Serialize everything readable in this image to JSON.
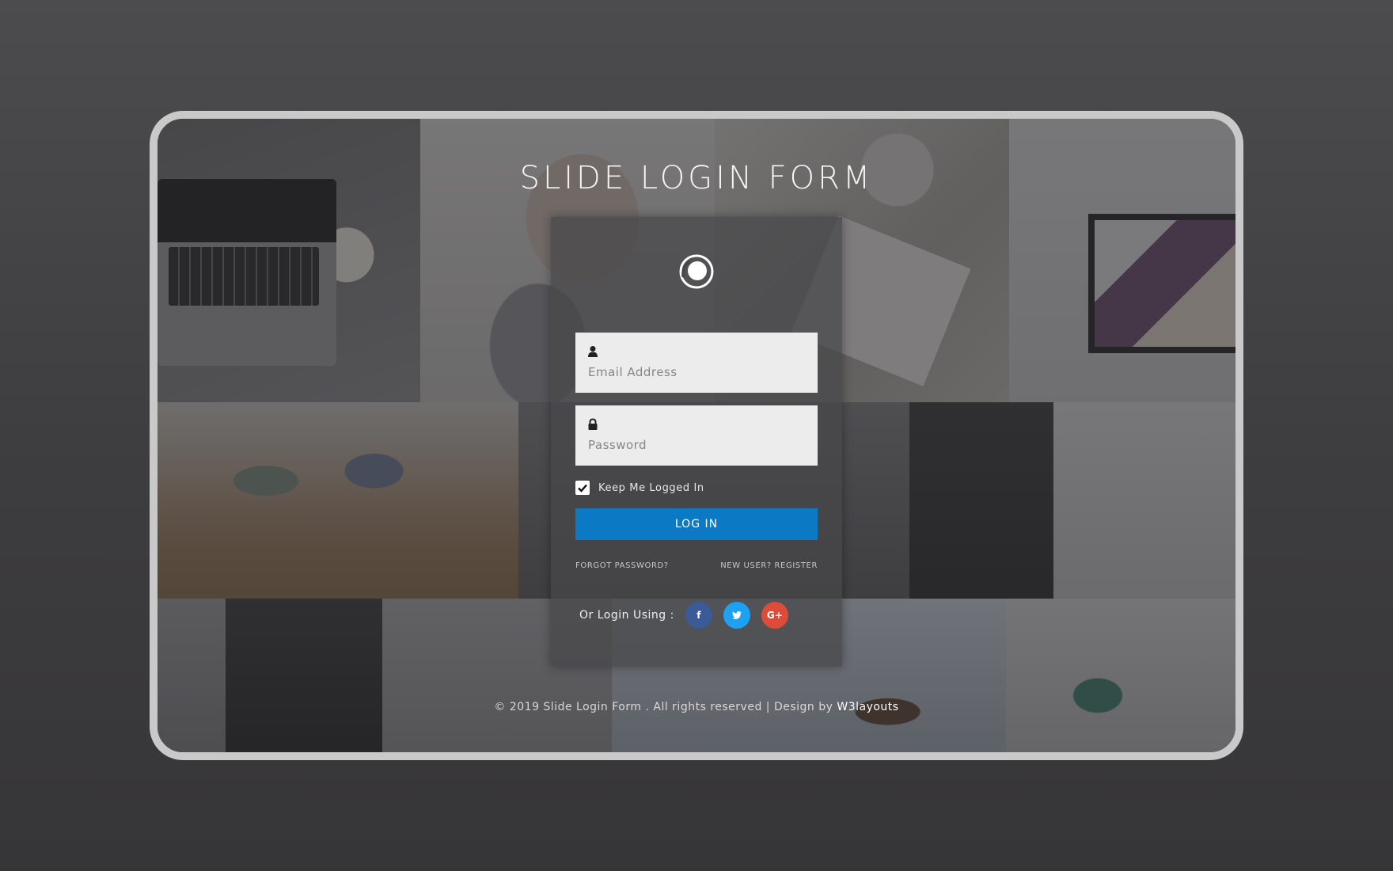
{
  "page": {
    "title": "SLIDE LOGIN FORM"
  },
  "form": {
    "email": {
      "value": "",
      "placeholder": "Email Address",
      "icon": "user-icon"
    },
    "password": {
      "value": "",
      "placeholder": "Password",
      "icon": "lock-icon"
    },
    "remember": {
      "label": "Keep Me Logged In",
      "checked": true
    },
    "login_label": "LOG IN",
    "forgot_label": "FORGOT PASSWORD?",
    "register_label": "NEW USER? REGISTER"
  },
  "social": {
    "label": "Or Login Using :",
    "buttons": [
      {
        "name": "facebook",
        "glyph": "f",
        "color": "#3a5a98"
      },
      {
        "name": "twitter",
        "glyph": "t",
        "color": "#1da1f2"
      },
      {
        "name": "google-plus",
        "glyph": "G+",
        "color": "#dd4b39"
      }
    ]
  },
  "footer": {
    "text": "© 2019 Slide Login Form . All rights reserved | Design by ",
    "link_label": "W3layouts"
  },
  "colors": {
    "primary_button": "#0b79c4",
    "frame_border": "#c9c9c9"
  }
}
